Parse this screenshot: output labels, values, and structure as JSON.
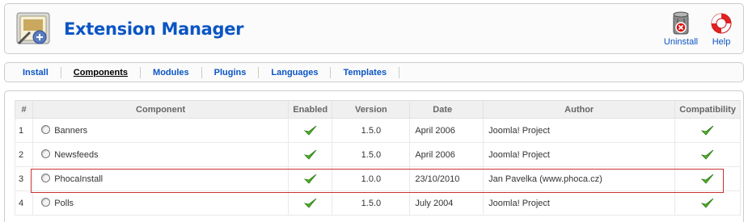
{
  "header": {
    "title": "Extension Manager",
    "icon": "extension-manager-icon",
    "toolbar": {
      "uninstall_label": "Uninstall",
      "help_label": "Help"
    }
  },
  "submenu": {
    "tabs": [
      {
        "label": "Install",
        "active": false
      },
      {
        "label": "Components",
        "active": true
      },
      {
        "label": "Modules",
        "active": false
      },
      {
        "label": "Plugins",
        "active": false
      },
      {
        "label": "Languages",
        "active": false
      },
      {
        "label": "Templates",
        "active": false
      }
    ]
  },
  "table": {
    "headers": {
      "num": "#",
      "component": "Component",
      "enabled": "Enabled",
      "version": "Version",
      "date": "Date",
      "author": "Author",
      "compatibility": "Compatibility"
    },
    "rows": [
      {
        "num": "1",
        "component": "Banners",
        "enabled": true,
        "version": "1.5.0",
        "date": "April 2006",
        "author": "Joomla! Project",
        "compatible": true
      },
      {
        "num": "2",
        "component": "Newsfeeds",
        "enabled": true,
        "version": "1.5.0",
        "date": "April 2006",
        "author": "Joomla! Project",
        "compatible": true
      },
      {
        "num": "3",
        "component": "PhocaInstall",
        "enabled": true,
        "version": "1.0.0",
        "date": "23/10/2010",
        "author": "Jan Pavelka (www.phoca.cz)",
        "compatible": true
      },
      {
        "num": "4",
        "component": "Polls",
        "enabled": true,
        "version": "1.5.0",
        "date": "July 2004",
        "author": "Joomla! Project",
        "compatible": true
      }
    ],
    "highlighted_row": "3"
  },
  "colors": {
    "link": "#0b55c4",
    "highlight_border": "#cc3333",
    "check": "#4caf28"
  }
}
